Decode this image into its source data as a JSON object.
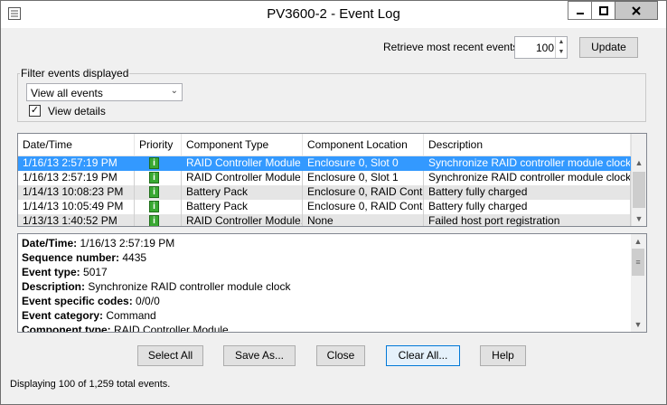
{
  "window": {
    "title": "PV3600-2 - Event Log"
  },
  "retrieve": {
    "label": "Retrieve most recent events:",
    "value": "100",
    "update_label": "Update"
  },
  "filter": {
    "group_label": "Filter events displayed",
    "selected": "View all events",
    "view_details_label": "View details",
    "view_details_checked": true
  },
  "table": {
    "columns": [
      "Date/Time",
      "Priority",
      "Component Type",
      "Component Location",
      "Description"
    ],
    "rows": [
      {
        "datetime": "1/16/13 2:57:19 PM",
        "priority": "info-icon",
        "component_type": "RAID Controller Module",
        "location": "Enclosure 0, Slot 0",
        "description": "Synchronize RAID controller module clock",
        "selected": true
      },
      {
        "datetime": "1/16/13 2:57:19 PM",
        "priority": "info-icon",
        "component_type": "RAID Controller Module",
        "location": "Enclosure 0, Slot 1",
        "description": "Synchronize RAID controller module clock",
        "selected": false
      },
      {
        "datetime": "1/14/13 10:08:23 PM",
        "priority": "info-icon",
        "component_type": "Battery Pack",
        "location": "Enclosure 0, RAID Cont...",
        "description": "Battery fully charged",
        "selected": false
      },
      {
        "datetime": "1/14/13 10:05:49 PM",
        "priority": "info-icon",
        "component_type": "Battery Pack",
        "location": "Enclosure 0, RAID Cont...",
        "description": "Battery fully charged",
        "selected": false
      },
      {
        "datetime": "1/13/13 1:40:52 PM",
        "priority": "info-icon",
        "component_type": "RAID Controller Module...",
        "location": "None",
        "description": "Failed host port registration",
        "selected": false
      }
    ]
  },
  "details": {
    "lines": [
      {
        "label": "Date/Time:",
        "value": " 1/16/13 2:57:19 PM"
      },
      {
        "label": "Sequence number:",
        "value": " 4435"
      },
      {
        "label": "Event type:",
        "value": " 5017"
      },
      {
        "label": "Description:",
        "value": " Synchronize RAID controller module clock"
      },
      {
        "label": "Event specific codes:",
        "value": " 0/0/0"
      },
      {
        "label": "Event category:",
        "value": " Command"
      },
      {
        "label": "Component type:",
        "value": " RAID Controller Module"
      }
    ]
  },
  "buttons": {
    "select_all": "Select All",
    "save_as": "Save As...",
    "close": "Close",
    "clear_all": "Clear All...",
    "help": "Help"
  },
  "status": "Displaying 100 of 1,259 total events."
}
